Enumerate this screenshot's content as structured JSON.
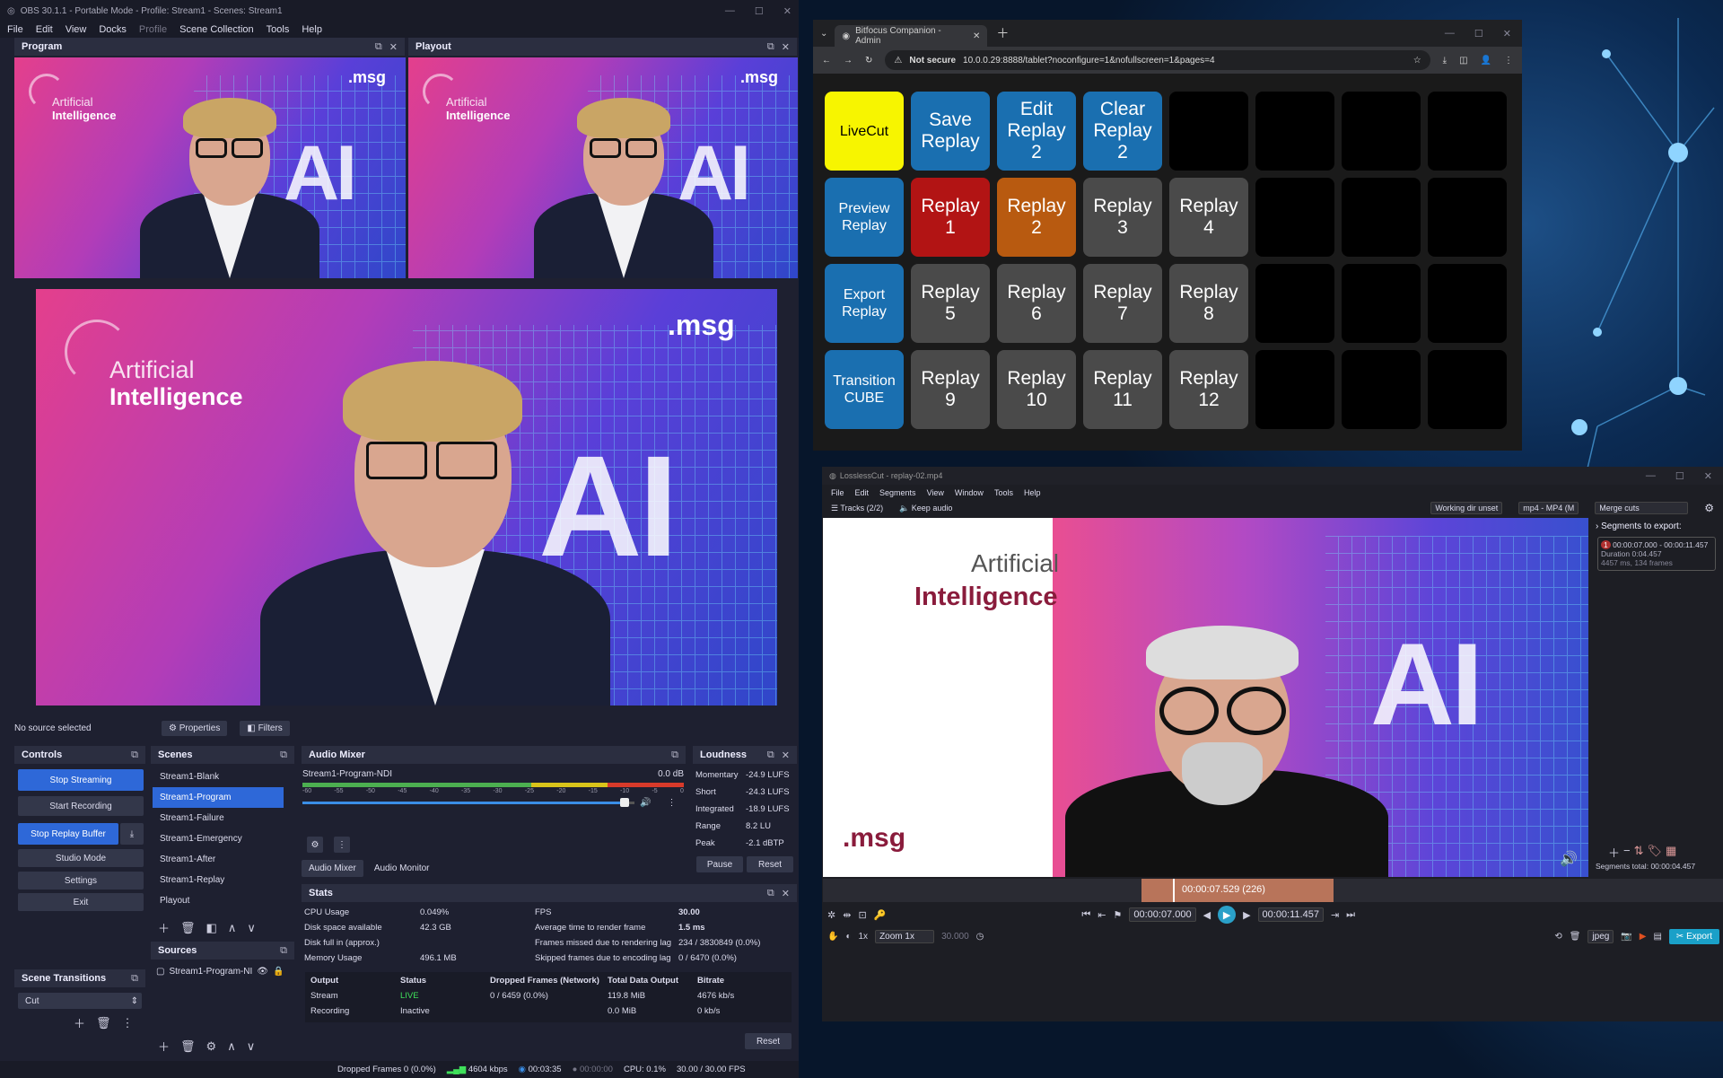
{
  "obs": {
    "title": "OBS 30.1.1 - Portable Mode - Profile: Stream1 - Scenes: Stream1",
    "menu": [
      "File",
      "Edit",
      "View",
      "Docks",
      "Profile",
      "Scene Collection",
      "Tools",
      "Help"
    ],
    "program_label": "Program",
    "playout_label": "Playout",
    "video": {
      "line1": "Artificial",
      "line2": "Intelligence",
      "brand": ".msg",
      "big": "AI"
    },
    "no_source": "No source selected",
    "properties": "Properties",
    "filters": "Filters",
    "controls": {
      "title": "Controls",
      "stop_streaming": "Stop Streaming",
      "start_recording": "Start Recording",
      "stop_replay": "Stop Replay Buffer",
      "studio_mode": "Studio Mode",
      "settings": "Settings",
      "exit": "Exit"
    },
    "scenes": {
      "title": "Scenes",
      "items": [
        "Stream1-Blank",
        "Stream1-Program",
        "Stream1-Failure",
        "Stream1-Emergency",
        "Stream1-After",
        "Stream1-Replay",
        "Playout"
      ]
    },
    "sources": {
      "title": "Sources",
      "item": "Stream1-Program-NI"
    },
    "transitions": {
      "title": "Scene Transitions",
      "value": "Cut"
    },
    "mixer": {
      "title": "Audio Mixer",
      "channel": "Stream1-Program-NDI",
      "db": "0.0 dB",
      "ticks": [
        "-60",
        "-55",
        "-50",
        "-45",
        "-40",
        "-35",
        "-30",
        "-25",
        "-20",
        "-15",
        "-10",
        "-5",
        "0"
      ],
      "tab1": "Audio Mixer",
      "tab2": "Audio Monitor",
      "level": 0.97
    },
    "loudness": {
      "title": "Loudness",
      "rows": [
        [
          "Momentary",
          "-24.9 LUFS"
        ],
        [
          "Short",
          "-24.3 LUFS"
        ],
        [
          "Integrated",
          "-18.9 LUFS"
        ],
        [
          "Range",
          "8.2 LU"
        ],
        [
          "Peak",
          "-2.1 dBTP"
        ]
      ],
      "pause": "Pause",
      "reset": "Reset"
    },
    "stats": {
      "title": "Stats",
      "left": [
        [
          "CPU Usage",
          "0.049%"
        ],
        [
          "Disk space available",
          "42.3 GB"
        ],
        [
          "Disk full in (approx.)",
          ""
        ],
        [
          "Memory Usage",
          "496.1 MB"
        ]
      ],
      "right": [
        [
          "FPS",
          "30.00"
        ],
        [
          "Average time to render frame",
          "1.5 ms"
        ],
        [
          "Frames missed due to rendering lag",
          "234 / 3830849 (0.0%)"
        ],
        [
          "Skipped frames due to encoding lag",
          "0 / 6470 (0.0%)"
        ]
      ],
      "headers": [
        "Output",
        "Status",
        "Dropped Frames (Network)",
        "Total Data Output",
        "Bitrate"
      ],
      "rows": [
        [
          "Stream",
          "LIVE",
          "0 / 6459 (0.0%)",
          "119.8 MiB",
          "4676 kb/s"
        ],
        [
          "Recording",
          "Inactive",
          "",
          "0.0 MiB",
          "0 kb/s"
        ]
      ],
      "reset": "Reset"
    },
    "status": {
      "dropped": "Dropped Frames 0 (0.0%)",
      "kbps": "4604 kbps",
      "live_time": "00:03:35",
      "rec_time": "00:00:00",
      "cpu": "CPU: 0.1%",
      "fps": "30.00 / 30.00 FPS"
    }
  },
  "companion": {
    "tab_title": "Bitfocus Companion - Admin",
    "not_secure": "Not secure",
    "url": "10.0.0.29:8888/tablet?noconfigure=1&nofullscreen=1&pages=4",
    "keys": [
      {
        "text": "LiveCut",
        "bg": "#f7f500",
        "fg": "#000",
        "small": true
      },
      {
        "text": "Save\nReplay",
        "bg": "#1a6fb0",
        "fg": "#fff"
      },
      {
        "text": "Edit\nReplay\n2",
        "bg": "#1a6fb0",
        "fg": "#fff"
      },
      {
        "text": "Clear\nReplay\n2",
        "bg": "#1a6fb0",
        "fg": "#fff"
      },
      {
        "text": "",
        "bg": "#000"
      },
      {
        "text": "",
        "bg": "#000"
      },
      {
        "text": "",
        "bg": "#000"
      },
      {
        "text": "",
        "bg": "#000"
      },
      {
        "text": "Preview\nReplay",
        "bg": "#1a6fb0",
        "fg": "#fff",
        "small": true
      },
      {
        "text": "Replay\n1",
        "bg": "#b21414",
        "fg": "#fff"
      },
      {
        "text": "Replay\n2",
        "bg": "#b85a10",
        "fg": "#fff"
      },
      {
        "text": "Replay\n3",
        "bg": "#4a4a4a",
        "fg": "#fff"
      },
      {
        "text": "Replay\n4",
        "bg": "#4a4a4a",
        "fg": "#fff"
      },
      {
        "text": "",
        "bg": "#000"
      },
      {
        "text": "",
        "bg": "#000"
      },
      {
        "text": "",
        "bg": "#000"
      },
      {
        "text": "Export\nReplay",
        "bg": "#1a6fb0",
        "fg": "#fff",
        "small": true
      },
      {
        "text": "Replay\n5",
        "bg": "#4a4a4a",
        "fg": "#fff"
      },
      {
        "text": "Replay\n6",
        "bg": "#4a4a4a",
        "fg": "#fff"
      },
      {
        "text": "Replay\n7",
        "bg": "#4a4a4a",
        "fg": "#fff"
      },
      {
        "text": "Replay\n8",
        "bg": "#4a4a4a",
        "fg": "#fff"
      },
      {
        "text": "",
        "bg": "#000"
      },
      {
        "text": "",
        "bg": "#000"
      },
      {
        "text": "",
        "bg": "#000"
      },
      {
        "text": "Transition\nCUBE",
        "bg": "#1a6fb0",
        "fg": "#fff",
        "small": true
      },
      {
        "text": "Replay\n9",
        "bg": "#4a4a4a",
        "fg": "#fff"
      },
      {
        "text": "Replay\n10",
        "bg": "#4a4a4a",
        "fg": "#fff"
      },
      {
        "text": "Replay\n11",
        "bg": "#4a4a4a",
        "fg": "#fff"
      },
      {
        "text": "Replay\n12",
        "bg": "#4a4a4a",
        "fg": "#fff"
      },
      {
        "text": "",
        "bg": "#000"
      },
      {
        "text": "",
        "bg": "#000"
      },
      {
        "text": "",
        "bg": "#000"
      }
    ]
  },
  "losslesscut": {
    "title": "LosslessCut - replay-02.mp4",
    "menu": [
      "File",
      "Edit",
      "Segments",
      "View",
      "Window",
      "Tools",
      "Help"
    ],
    "tracks": "Tracks (2/2)",
    "keep_audio": "Keep audio",
    "working_dir": "Working dir unset",
    "format": "mp4 - MP4 (M",
    "merge": "Merge cuts",
    "segments_title": "Segments to export:",
    "segment": {
      "num": "1",
      "range": "00:00:07.000 - 00:00:11.457",
      "duration": "Duration 0:04.457",
      "frames": "4457 ms, 134 frames"
    },
    "segments_total": "Segments total:",
    "segments_total_value": "00:00:04.457",
    "video": {
      "line1": "Artificial",
      "line2": "Intelligence",
      "brand": ".msg",
      "big": "AI"
    },
    "current_time": "00:00:07.529 (226)",
    "start_time": "00:00:07.000",
    "end_time": "00:00:11.457",
    "speed": "1x",
    "zoom": "Zoom 1x",
    "fps": "30.000",
    "snapshot_format": "jpeg",
    "export": "Export"
  }
}
